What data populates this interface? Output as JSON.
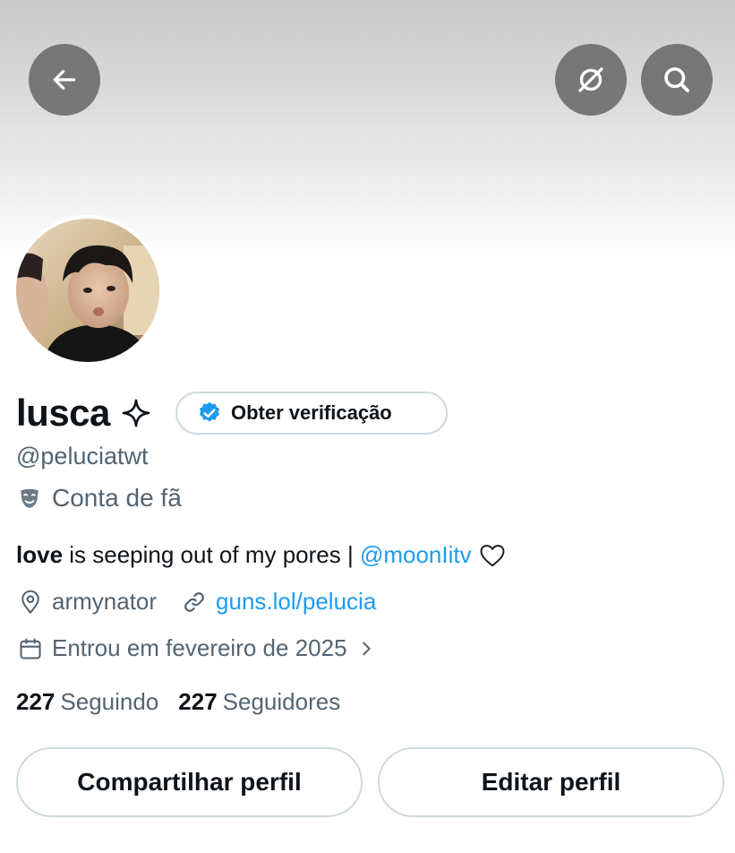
{
  "profile": {
    "display_name": "lusca",
    "verify_label": "Obter verificação",
    "handle": "@peluciatwt",
    "fan_label": "Conta de fã",
    "bio": {
      "bold": "love",
      "text": " is seeping out of my pores | ",
      "mention": "@moonIitv"
    },
    "location": "armynator",
    "website": "guns.lol/pelucia",
    "joined": "Entrou em fevereiro de 2025",
    "following_count": "227",
    "following_label": "Seguindo",
    "followers_count": "227",
    "followers_label": "Seguidores"
  },
  "actions": {
    "share_label": "Compartilhar perfil",
    "edit_label": "Editar perfil"
  },
  "colors": {
    "accent": "#1d9bf0",
    "secondary_text": "#536471",
    "primary_text": "#0f1419",
    "border": "#cfd9de"
  },
  "icons": [
    "back-arrow-icon",
    "translate-icon",
    "search-icon",
    "sparkle-icon",
    "verified-badge-icon",
    "theater-mask-icon",
    "heart-icon",
    "location-pin-icon",
    "link-icon",
    "calendar-icon",
    "chevron-right-icon"
  ]
}
